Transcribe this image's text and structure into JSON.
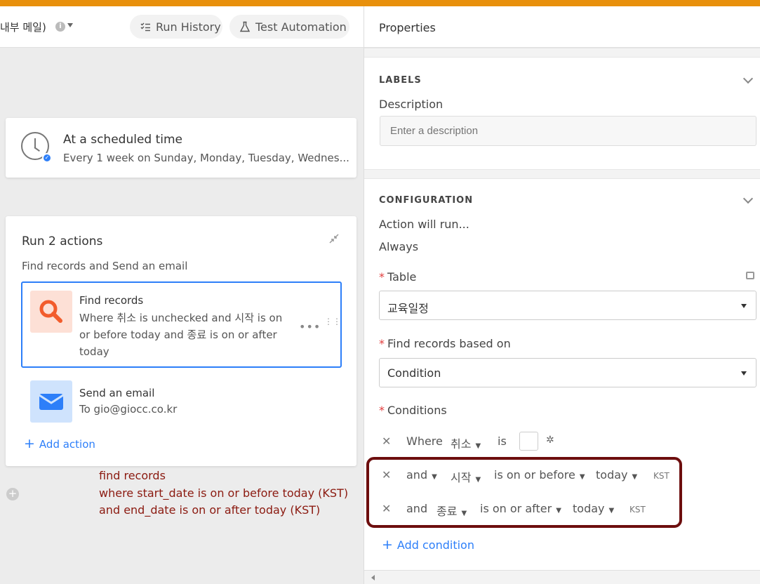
{
  "header": {
    "automation_name": "내부 메일)",
    "run_history": "Run History",
    "test_automation": "Test Automation"
  },
  "trigger": {
    "title": "At a scheduled time",
    "subtitle": "Every 1 week on Sunday, Monday, Tuesday, Wednes..."
  },
  "actions": {
    "title": "Run 2 actions",
    "subtitle": "Find records and Send an email",
    "items": [
      {
        "title": "Find records",
        "description": "Where 취소 is unchecked and 시작 is on or before today and 종료 is on or after today",
        "icon": "search-icon",
        "color": "#f25c2c"
      },
      {
        "title": "Send an email",
        "description": "To gio@giocc.co.kr",
        "icon": "envelope-icon",
        "color": "#2d7ff9"
      }
    ],
    "add_action": "Add action"
  },
  "annotation": {
    "line1": "find records",
    "line2": "where start_date is on or before today (KST)",
    "line3": "and end_date is on or after today (KST)"
  },
  "properties": {
    "title": "Properties",
    "labels_section": "LABELS",
    "description_label": "Description",
    "description_placeholder": "Enter a description",
    "configuration_section": "CONFIGURATION",
    "action_will_run": "Action will run...",
    "always": "Always",
    "table_label": "Table",
    "table_value": "교육일정",
    "find_based_label": "Find records based on",
    "find_based_value": "Condition",
    "conditions_label": "Conditions",
    "conditions": [
      {
        "conj": "Where",
        "field": "취소",
        "op": "is",
        "value": "",
        "tz": ""
      },
      {
        "conj": "and",
        "field": "시작",
        "op": "is on or before",
        "value": "today",
        "tz": "KST"
      },
      {
        "conj": "and",
        "field": "종료",
        "op": "is on or after",
        "value": "today",
        "tz": "KST"
      }
    ],
    "add_condition": "Add condition"
  },
  "colors": {
    "accent": "#2d7ff9",
    "topbar": "#e8900c",
    "annotation": "#8b1a10",
    "highlight_border": "#6d0e0e"
  }
}
